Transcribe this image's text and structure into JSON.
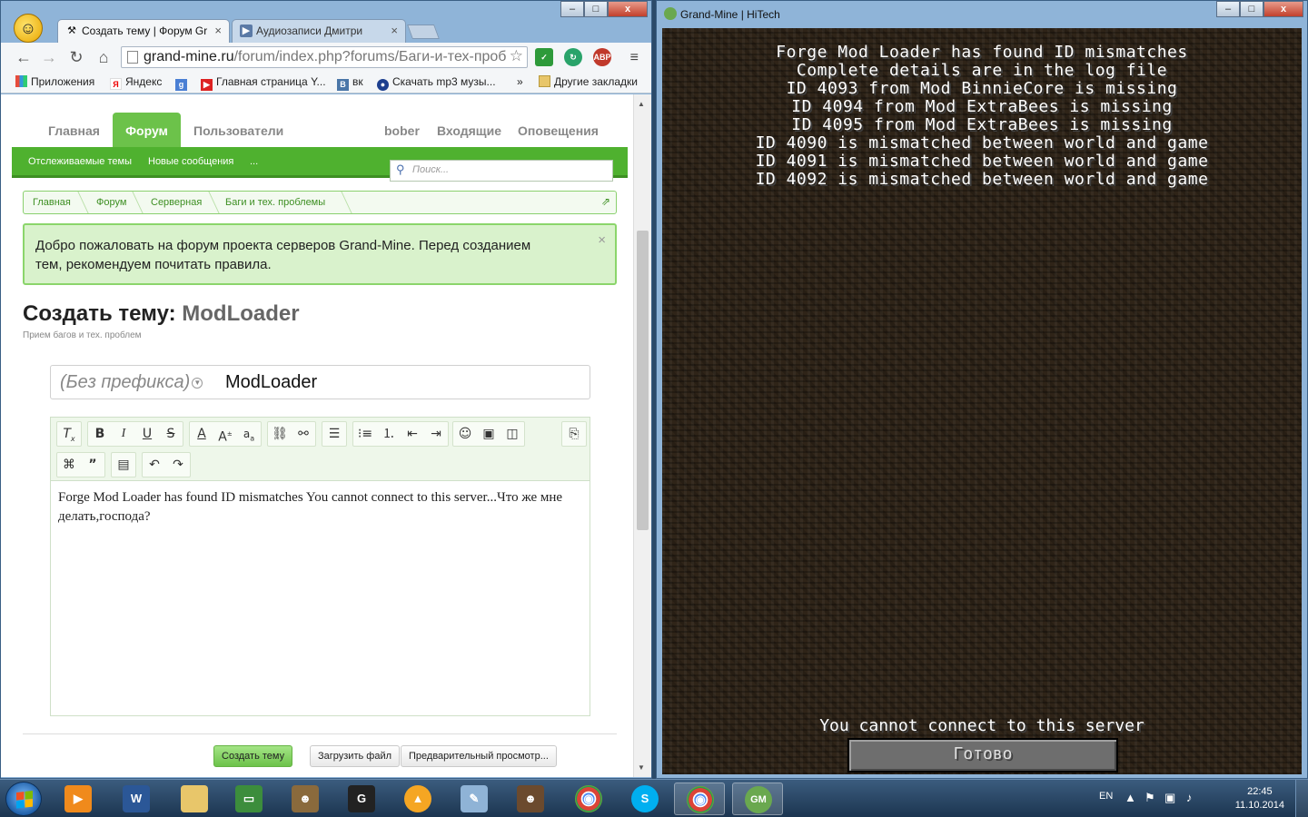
{
  "browser": {
    "tabs": [
      {
        "label": "Создать тему | Форум Gr",
        "active": true
      },
      {
        "label": "Аудиозаписи Дмитри",
        "active": false
      }
    ],
    "url_host": "grand-mine.ru",
    "url_path": "/forum/index.php?forums/Баги-и-тех-проб",
    "bookmarks": [
      "Приложения",
      "Яндекс",
      "Главная страница Y...",
      "вк",
      "Скачать mp3 музы...",
      "»",
      "Другие закладки"
    ],
    "ext_abp": "ABP",
    "bookmark_icons": {
      "yandex": "Я",
      "google": "g",
      "vk": "B"
    }
  },
  "forum": {
    "nav": [
      "Главная",
      "Форум",
      "Пользователи"
    ],
    "nav_right": [
      "bober",
      "Входящие",
      "Оповещения"
    ],
    "subnav": [
      "Отслеживаемые темы",
      "Новые сообщения",
      "..."
    ],
    "search_placeholder": "Поиск...",
    "breadcrumbs": [
      "Главная",
      "Форум",
      "Серверная",
      "Баги и тех. проблемы"
    ],
    "notice": "Добро пожаловать на форум проекта серверов Grand-Mine. Перед созданием тем, рекомендуем почитать правила.",
    "page_title_prefix": "Создать тему:",
    "page_title_topic": "ModLoader",
    "page_subtitle": "Прием багов и тех. проблем",
    "prefix_select": "(Без префикса)",
    "thread_title": "ModLoader",
    "message": "Forge Mod Loader has found ID mismatches You cannot connect to this server...Что же мне делать,господа?",
    "buttons": {
      "create": "Создать тему",
      "upload": "Загрузить файл",
      "preview": "Предварительный просмотр..."
    }
  },
  "minecraft": {
    "window_title": "Grand-Mine | HiTech",
    "lines": [
      "Forge Mod Loader has found ID mismatches",
      "Complete details are in the log file",
      "ID 4093 from Mod BinnieCore is missing",
      "ID 4094 from Mod ExtraBees is missing",
      "ID 4095 from Mod ExtraBees is missing",
      "ID 4090 is mismatched between world and game",
      "ID 4091 is mismatched between world and game",
      "ID 4092 is mismatched between world and game"
    ],
    "status": "You cannot connect to this server",
    "button": "Готово"
  },
  "taskbar": {
    "lang": "EN",
    "time": "22:45",
    "date": "11.10.2014",
    "apps": [
      "Media player",
      "Word",
      "Explorer",
      "Task manager",
      "Game",
      "Gens",
      "VLC",
      "Paint",
      "Game 2",
      "Chrome",
      "Skype",
      "Chrome",
      "Grand-Mine launcher"
    ],
    "app_labels": {
      "word": "W",
      "gens": "G",
      "chrome": "◉",
      "skype": "S",
      "launcher": "GM"
    }
  },
  "colors": {
    "forum_green": "#4fb12f",
    "notice_bg": "#d9f2cc",
    "mc_bg": "#2f2418",
    "mc_text": "#ffffff"
  }
}
